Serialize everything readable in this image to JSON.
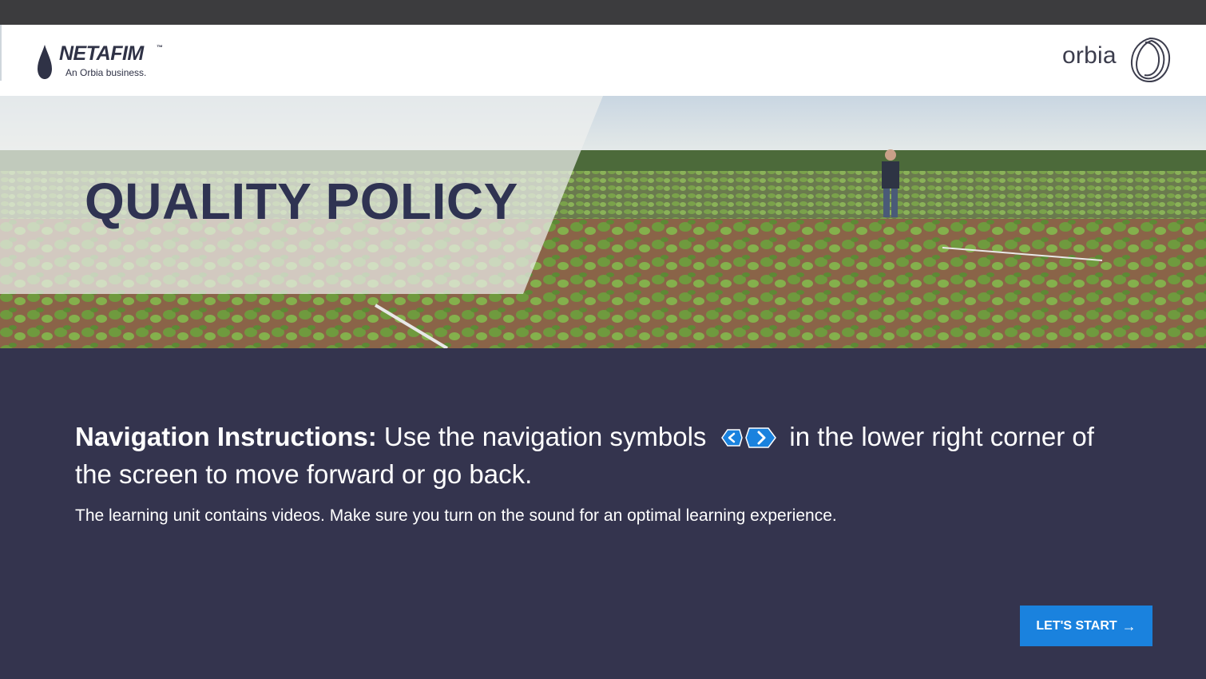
{
  "header": {
    "left_logo": {
      "name": "NETAFIM",
      "trademark": "™",
      "tagline": "An Orbia business."
    },
    "right_logo": {
      "name": "orbia"
    }
  },
  "hero": {
    "title": "QUALITY POLICY"
  },
  "instructions": {
    "label": "Navigation Instructions:",
    "text_before_icons": " Use the navigation symbols",
    "text_after_icons": "in the lower right corner of the screen to move forward or go back.",
    "note": "The learning unit contains videos. Make sure you turn on the sound for an optimal learning experience.",
    "icons": [
      "chevron-left-icon",
      "chevron-right-icon"
    ]
  },
  "cta": {
    "label": "LET'S START",
    "icon": "arrow-right-icon"
  },
  "colors": {
    "background": "#34344e",
    "topbar": "#3c3c3e",
    "accent": "#1a82de",
    "title": "#2f3352",
    "white": "#ffffff"
  }
}
